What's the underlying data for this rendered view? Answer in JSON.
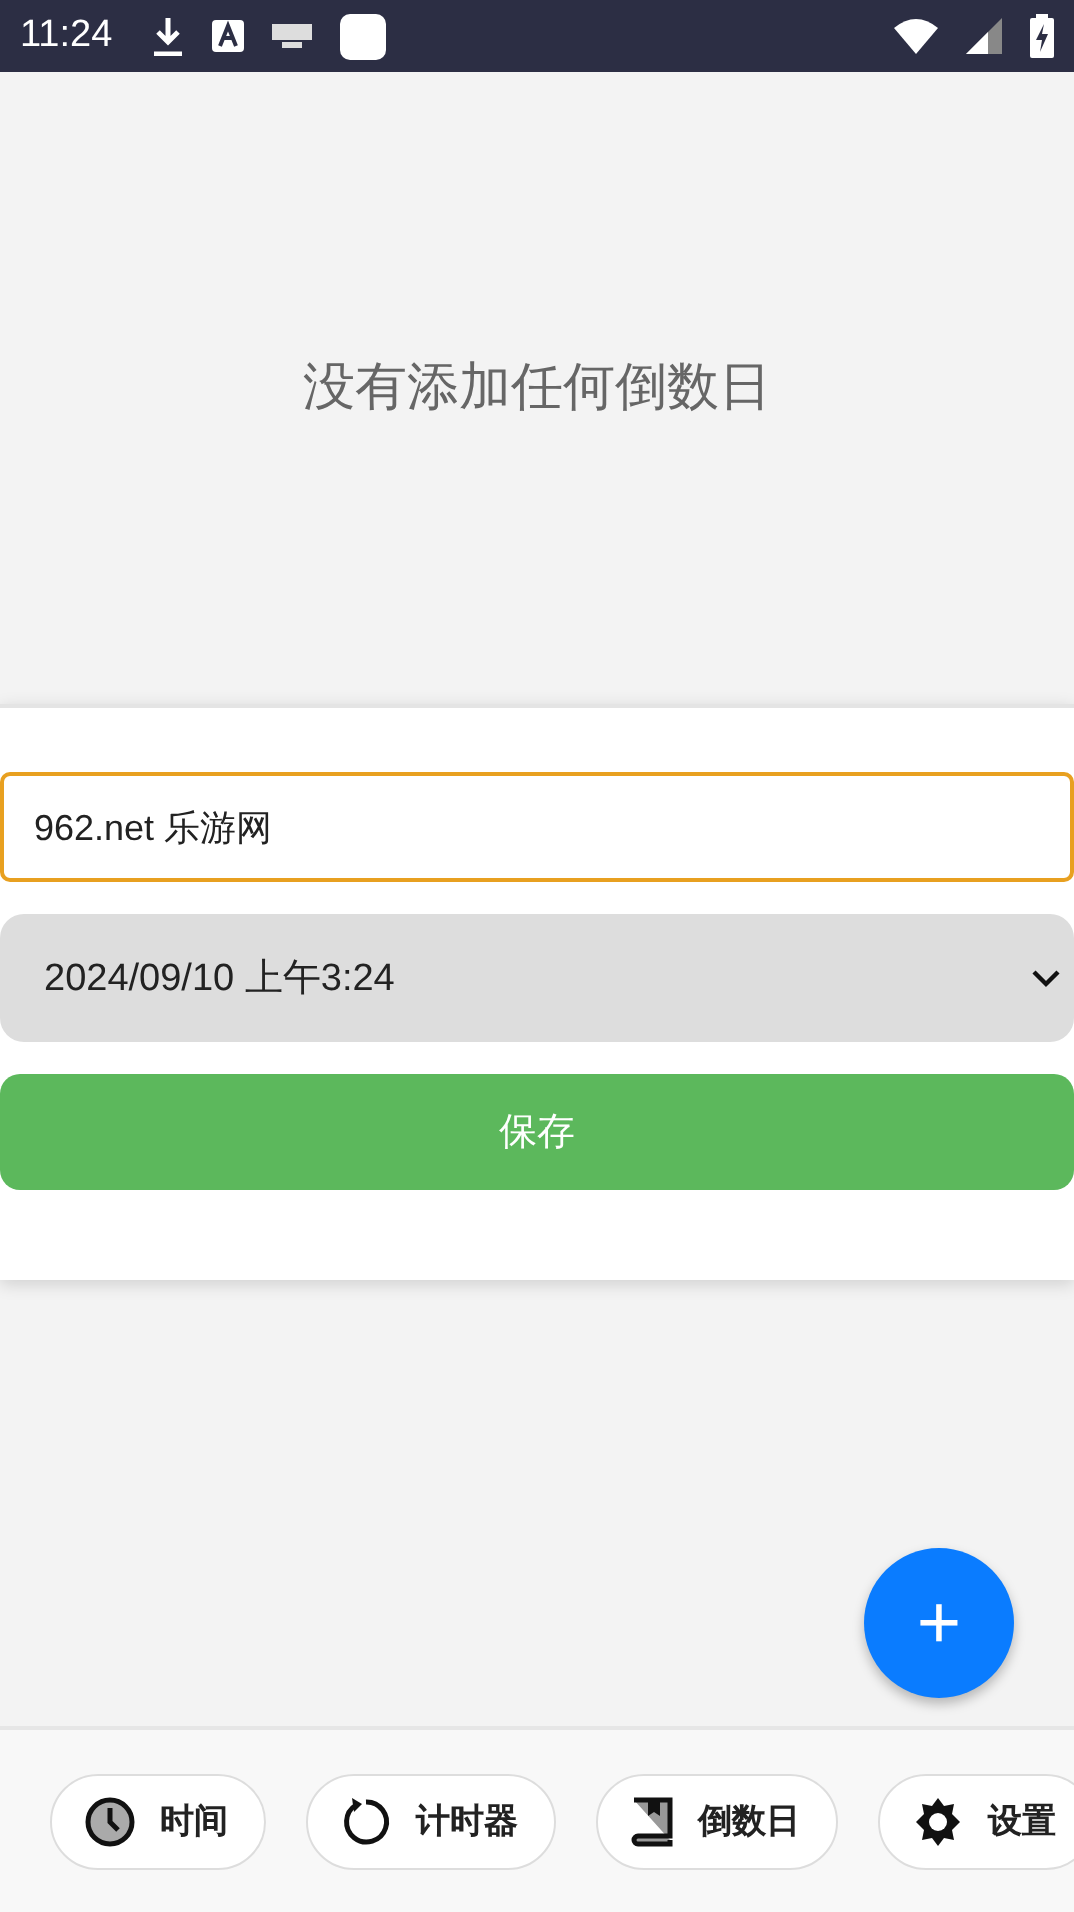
{
  "status_bar": {
    "time": "11:24"
  },
  "empty_message": "没有添加任何倒数日",
  "form": {
    "name_value": "962.net 乐游网",
    "date_value": "2024/09/10 上午3:24",
    "save_label": "保存"
  },
  "fab": {
    "label": "+"
  },
  "nav": [
    {
      "kind": "clock",
      "label": "时间"
    },
    {
      "kind": "timer",
      "label": "计时器"
    },
    {
      "kind": "book",
      "label": "倒数日"
    },
    {
      "kind": "gear",
      "label": "设置"
    }
  ]
}
